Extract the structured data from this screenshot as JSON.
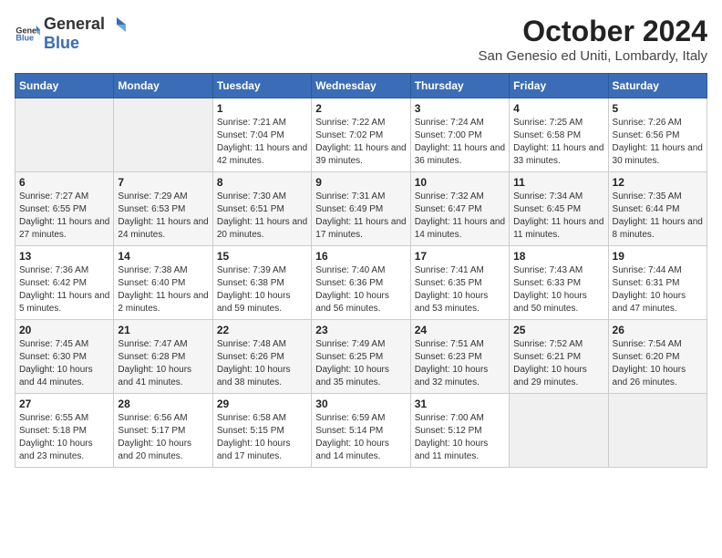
{
  "header": {
    "logo_general": "General",
    "logo_blue": "Blue",
    "title": "October 2024",
    "subtitle": "San Genesio ed Uniti, Lombardy, Italy"
  },
  "days_of_week": [
    "Sunday",
    "Monday",
    "Tuesday",
    "Wednesday",
    "Thursday",
    "Friday",
    "Saturday"
  ],
  "weeks": [
    [
      {
        "day": "",
        "info": ""
      },
      {
        "day": "",
        "info": ""
      },
      {
        "day": "1",
        "info": "Sunrise: 7:21 AM\nSunset: 7:04 PM\nDaylight: 11 hours and 42 minutes."
      },
      {
        "day": "2",
        "info": "Sunrise: 7:22 AM\nSunset: 7:02 PM\nDaylight: 11 hours and 39 minutes."
      },
      {
        "day": "3",
        "info": "Sunrise: 7:24 AM\nSunset: 7:00 PM\nDaylight: 11 hours and 36 minutes."
      },
      {
        "day": "4",
        "info": "Sunrise: 7:25 AM\nSunset: 6:58 PM\nDaylight: 11 hours and 33 minutes."
      },
      {
        "day": "5",
        "info": "Sunrise: 7:26 AM\nSunset: 6:56 PM\nDaylight: 11 hours and 30 minutes."
      }
    ],
    [
      {
        "day": "6",
        "info": "Sunrise: 7:27 AM\nSunset: 6:55 PM\nDaylight: 11 hours and 27 minutes."
      },
      {
        "day": "7",
        "info": "Sunrise: 7:29 AM\nSunset: 6:53 PM\nDaylight: 11 hours and 24 minutes."
      },
      {
        "day": "8",
        "info": "Sunrise: 7:30 AM\nSunset: 6:51 PM\nDaylight: 11 hours and 20 minutes."
      },
      {
        "day": "9",
        "info": "Sunrise: 7:31 AM\nSunset: 6:49 PM\nDaylight: 11 hours and 17 minutes."
      },
      {
        "day": "10",
        "info": "Sunrise: 7:32 AM\nSunset: 6:47 PM\nDaylight: 11 hours and 14 minutes."
      },
      {
        "day": "11",
        "info": "Sunrise: 7:34 AM\nSunset: 6:45 PM\nDaylight: 11 hours and 11 minutes."
      },
      {
        "day": "12",
        "info": "Sunrise: 7:35 AM\nSunset: 6:44 PM\nDaylight: 11 hours and 8 minutes."
      }
    ],
    [
      {
        "day": "13",
        "info": "Sunrise: 7:36 AM\nSunset: 6:42 PM\nDaylight: 11 hours and 5 minutes."
      },
      {
        "day": "14",
        "info": "Sunrise: 7:38 AM\nSunset: 6:40 PM\nDaylight: 11 hours and 2 minutes."
      },
      {
        "day": "15",
        "info": "Sunrise: 7:39 AM\nSunset: 6:38 PM\nDaylight: 10 hours and 59 minutes."
      },
      {
        "day": "16",
        "info": "Sunrise: 7:40 AM\nSunset: 6:36 PM\nDaylight: 10 hours and 56 minutes."
      },
      {
        "day": "17",
        "info": "Sunrise: 7:41 AM\nSunset: 6:35 PM\nDaylight: 10 hours and 53 minutes."
      },
      {
        "day": "18",
        "info": "Sunrise: 7:43 AM\nSunset: 6:33 PM\nDaylight: 10 hours and 50 minutes."
      },
      {
        "day": "19",
        "info": "Sunrise: 7:44 AM\nSunset: 6:31 PM\nDaylight: 10 hours and 47 minutes."
      }
    ],
    [
      {
        "day": "20",
        "info": "Sunrise: 7:45 AM\nSunset: 6:30 PM\nDaylight: 10 hours and 44 minutes."
      },
      {
        "day": "21",
        "info": "Sunrise: 7:47 AM\nSunset: 6:28 PM\nDaylight: 10 hours and 41 minutes."
      },
      {
        "day": "22",
        "info": "Sunrise: 7:48 AM\nSunset: 6:26 PM\nDaylight: 10 hours and 38 minutes."
      },
      {
        "day": "23",
        "info": "Sunrise: 7:49 AM\nSunset: 6:25 PM\nDaylight: 10 hours and 35 minutes."
      },
      {
        "day": "24",
        "info": "Sunrise: 7:51 AM\nSunset: 6:23 PM\nDaylight: 10 hours and 32 minutes."
      },
      {
        "day": "25",
        "info": "Sunrise: 7:52 AM\nSunset: 6:21 PM\nDaylight: 10 hours and 29 minutes."
      },
      {
        "day": "26",
        "info": "Sunrise: 7:54 AM\nSunset: 6:20 PM\nDaylight: 10 hours and 26 minutes."
      }
    ],
    [
      {
        "day": "27",
        "info": "Sunrise: 6:55 AM\nSunset: 5:18 PM\nDaylight: 10 hours and 23 minutes."
      },
      {
        "day": "28",
        "info": "Sunrise: 6:56 AM\nSunset: 5:17 PM\nDaylight: 10 hours and 20 minutes."
      },
      {
        "day": "29",
        "info": "Sunrise: 6:58 AM\nSunset: 5:15 PM\nDaylight: 10 hours and 17 minutes."
      },
      {
        "day": "30",
        "info": "Sunrise: 6:59 AM\nSunset: 5:14 PM\nDaylight: 10 hours and 14 minutes."
      },
      {
        "day": "31",
        "info": "Sunrise: 7:00 AM\nSunset: 5:12 PM\nDaylight: 10 hours and 11 minutes."
      },
      {
        "day": "",
        "info": ""
      },
      {
        "day": "",
        "info": ""
      }
    ]
  ]
}
